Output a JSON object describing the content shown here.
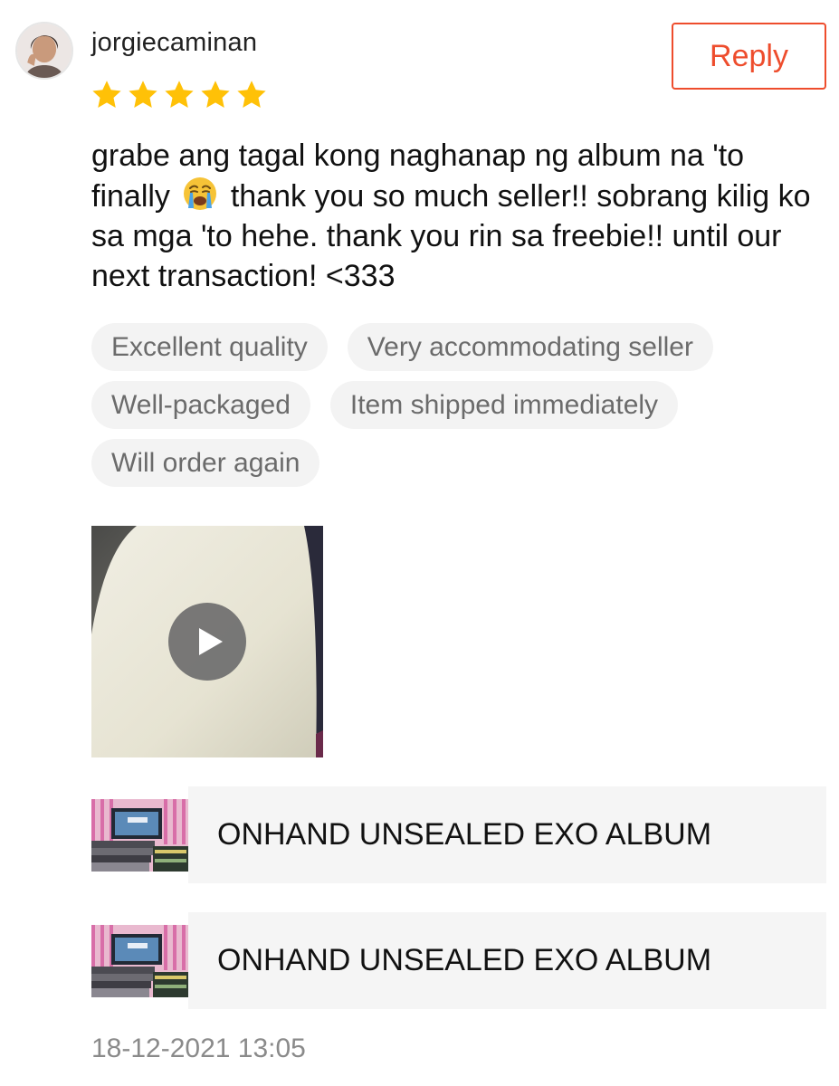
{
  "review": {
    "username": "jorgiecaminan",
    "rating": 5,
    "rating_max": 5,
    "reply_label": "Reply",
    "comment": {
      "part1": "grabe ang tagal kong naghanap ng album na 'to finally",
      "emoji": "loudly-crying-face",
      "part2": "thank you so much seller!! sobrang kilig ko sa mga 'to hehe. thank you rin sa freebie!! until our next transaction! <333"
    },
    "tags": [
      [
        "Excellent quality",
        "Very accommodating seller"
      ],
      [
        "Well-packaged",
        "Item shipped immediately"
      ],
      [
        "Will order again"
      ]
    ],
    "media": {
      "type": "video",
      "icon": "play-icon"
    },
    "products": [
      {
        "name": "ONHAND UNSEALED EXO ALBUM"
      },
      {
        "name": "ONHAND UNSEALED EXO ALBUM"
      }
    ],
    "timestamp": "18-12-2021 13:05"
  },
  "colors": {
    "accent": "#ee4d2d",
    "star": "#ffc107",
    "tag_bg": "#f3f3f3",
    "tag_text": "#6b6b6b",
    "muted_text": "#8a8a8a"
  }
}
